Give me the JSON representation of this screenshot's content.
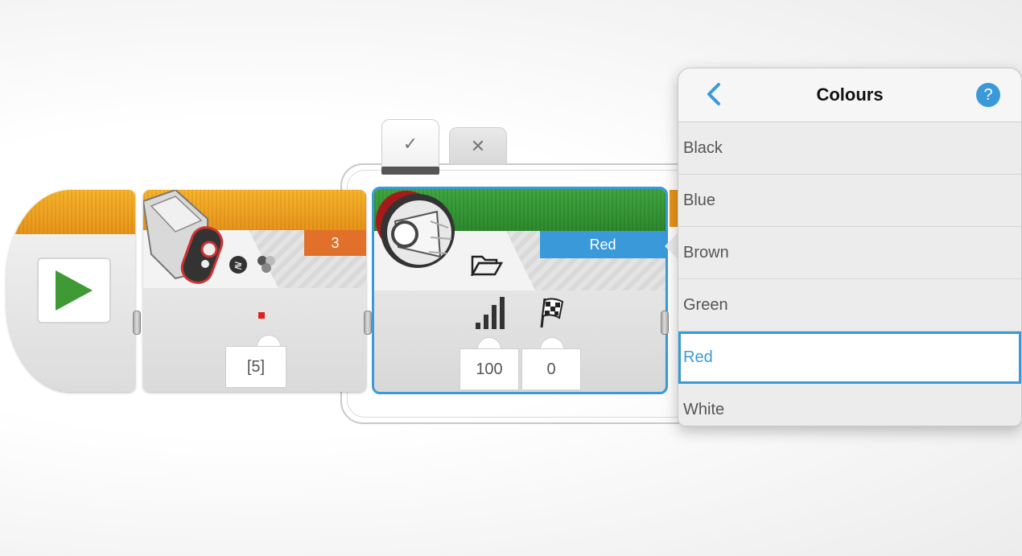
{
  "case_tabs": {
    "true_icon": "✓",
    "false_icon": "✕"
  },
  "start_block": {
    "icon": "play-triangle-icon"
  },
  "color_sensor_block": {
    "port": "3",
    "mode_icons": "color-sensor-mode-icon",
    "indicator_color": "#e02020",
    "input_value": "[5]"
  },
  "sound_block": {
    "mode_icon": "folder-icon",
    "color_label": "Red",
    "volume_value": "100",
    "play_type_value": "0"
  },
  "colours_panel": {
    "title": "Colours",
    "help_label": "?",
    "options": [
      "Black",
      "Blue",
      "Brown",
      "Green",
      "Red",
      "White"
    ],
    "selected": "Red"
  },
  "colors": {
    "accent": "#3a9ad9",
    "orange": "#e8941a",
    "green": "#3fa63f",
    "port_orange": "#e0702a"
  }
}
